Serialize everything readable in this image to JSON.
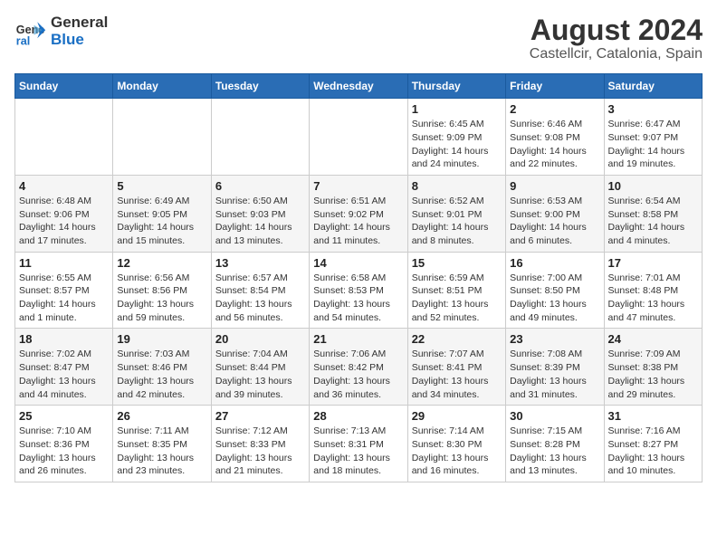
{
  "header": {
    "logo_line1": "General",
    "logo_line2": "Blue",
    "title": "August 2024",
    "subtitle": "Castellcir, Catalonia, Spain"
  },
  "days_of_week": [
    "Sunday",
    "Monday",
    "Tuesday",
    "Wednesday",
    "Thursday",
    "Friday",
    "Saturday"
  ],
  "weeks": [
    [
      {
        "num": "",
        "info": ""
      },
      {
        "num": "",
        "info": ""
      },
      {
        "num": "",
        "info": ""
      },
      {
        "num": "",
        "info": ""
      },
      {
        "num": "1",
        "info": "Sunrise: 6:45 AM\nSunset: 9:09 PM\nDaylight: 14 hours\nand 24 minutes."
      },
      {
        "num": "2",
        "info": "Sunrise: 6:46 AM\nSunset: 9:08 PM\nDaylight: 14 hours\nand 22 minutes."
      },
      {
        "num": "3",
        "info": "Sunrise: 6:47 AM\nSunset: 9:07 PM\nDaylight: 14 hours\nand 19 minutes."
      }
    ],
    [
      {
        "num": "4",
        "info": "Sunrise: 6:48 AM\nSunset: 9:06 PM\nDaylight: 14 hours\nand 17 minutes."
      },
      {
        "num": "5",
        "info": "Sunrise: 6:49 AM\nSunset: 9:05 PM\nDaylight: 14 hours\nand 15 minutes."
      },
      {
        "num": "6",
        "info": "Sunrise: 6:50 AM\nSunset: 9:03 PM\nDaylight: 14 hours\nand 13 minutes."
      },
      {
        "num": "7",
        "info": "Sunrise: 6:51 AM\nSunset: 9:02 PM\nDaylight: 14 hours\nand 11 minutes."
      },
      {
        "num": "8",
        "info": "Sunrise: 6:52 AM\nSunset: 9:01 PM\nDaylight: 14 hours\nand 8 minutes."
      },
      {
        "num": "9",
        "info": "Sunrise: 6:53 AM\nSunset: 9:00 PM\nDaylight: 14 hours\nand 6 minutes."
      },
      {
        "num": "10",
        "info": "Sunrise: 6:54 AM\nSunset: 8:58 PM\nDaylight: 14 hours\nand 4 minutes."
      }
    ],
    [
      {
        "num": "11",
        "info": "Sunrise: 6:55 AM\nSunset: 8:57 PM\nDaylight: 14 hours\nand 1 minute."
      },
      {
        "num": "12",
        "info": "Sunrise: 6:56 AM\nSunset: 8:56 PM\nDaylight: 13 hours\nand 59 minutes."
      },
      {
        "num": "13",
        "info": "Sunrise: 6:57 AM\nSunset: 8:54 PM\nDaylight: 13 hours\nand 56 minutes."
      },
      {
        "num": "14",
        "info": "Sunrise: 6:58 AM\nSunset: 8:53 PM\nDaylight: 13 hours\nand 54 minutes."
      },
      {
        "num": "15",
        "info": "Sunrise: 6:59 AM\nSunset: 8:51 PM\nDaylight: 13 hours\nand 52 minutes."
      },
      {
        "num": "16",
        "info": "Sunrise: 7:00 AM\nSunset: 8:50 PM\nDaylight: 13 hours\nand 49 minutes."
      },
      {
        "num": "17",
        "info": "Sunrise: 7:01 AM\nSunset: 8:48 PM\nDaylight: 13 hours\nand 47 minutes."
      }
    ],
    [
      {
        "num": "18",
        "info": "Sunrise: 7:02 AM\nSunset: 8:47 PM\nDaylight: 13 hours\nand 44 minutes."
      },
      {
        "num": "19",
        "info": "Sunrise: 7:03 AM\nSunset: 8:46 PM\nDaylight: 13 hours\nand 42 minutes."
      },
      {
        "num": "20",
        "info": "Sunrise: 7:04 AM\nSunset: 8:44 PM\nDaylight: 13 hours\nand 39 minutes."
      },
      {
        "num": "21",
        "info": "Sunrise: 7:06 AM\nSunset: 8:42 PM\nDaylight: 13 hours\nand 36 minutes."
      },
      {
        "num": "22",
        "info": "Sunrise: 7:07 AM\nSunset: 8:41 PM\nDaylight: 13 hours\nand 34 minutes."
      },
      {
        "num": "23",
        "info": "Sunrise: 7:08 AM\nSunset: 8:39 PM\nDaylight: 13 hours\nand 31 minutes."
      },
      {
        "num": "24",
        "info": "Sunrise: 7:09 AM\nSunset: 8:38 PM\nDaylight: 13 hours\nand 29 minutes."
      }
    ],
    [
      {
        "num": "25",
        "info": "Sunrise: 7:10 AM\nSunset: 8:36 PM\nDaylight: 13 hours\nand 26 minutes."
      },
      {
        "num": "26",
        "info": "Sunrise: 7:11 AM\nSunset: 8:35 PM\nDaylight: 13 hours\nand 23 minutes."
      },
      {
        "num": "27",
        "info": "Sunrise: 7:12 AM\nSunset: 8:33 PM\nDaylight: 13 hours\nand 21 minutes."
      },
      {
        "num": "28",
        "info": "Sunrise: 7:13 AM\nSunset: 8:31 PM\nDaylight: 13 hours\nand 18 minutes."
      },
      {
        "num": "29",
        "info": "Sunrise: 7:14 AM\nSunset: 8:30 PM\nDaylight: 13 hours\nand 16 minutes."
      },
      {
        "num": "30",
        "info": "Sunrise: 7:15 AM\nSunset: 8:28 PM\nDaylight: 13 hours\nand 13 minutes."
      },
      {
        "num": "31",
        "info": "Sunrise: 7:16 AM\nSunset: 8:27 PM\nDaylight: 13 hours\nand 10 minutes."
      }
    ]
  ]
}
